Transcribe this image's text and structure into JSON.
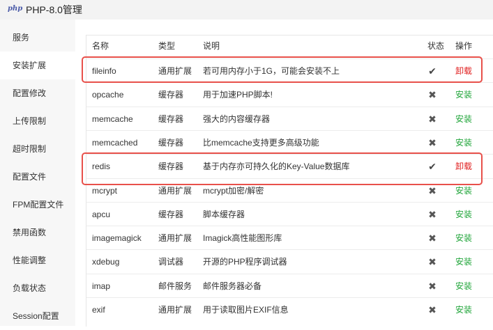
{
  "window": {
    "logo": "php",
    "title": "PHP-8.0管理"
  },
  "sidebar": {
    "items": [
      {
        "label": "服务"
      },
      {
        "label": "安装扩展"
      },
      {
        "label": "配置修改"
      },
      {
        "label": "上传限制"
      },
      {
        "label": "超时限制"
      },
      {
        "label": "配置文件"
      },
      {
        "label": "FPM配置文件"
      },
      {
        "label": "禁用函数"
      },
      {
        "label": "性能调整"
      },
      {
        "label": "负载状态"
      },
      {
        "label": "Session配置"
      }
    ],
    "active": "安装扩展"
  },
  "table": {
    "headers": {
      "name": "名称",
      "type": "类型",
      "desc": "说明",
      "status": "状态",
      "op": "操作"
    },
    "rows": [
      {
        "name": "fileinfo",
        "type": "通用扩展",
        "desc": "若可用内存小于1G，可能会安装不上",
        "installed": true,
        "op": "卸载"
      },
      {
        "name": "opcache",
        "type": "缓存器",
        "desc": "用于加速PHP脚本!",
        "installed": false,
        "op": "安装"
      },
      {
        "name": "memcache",
        "type": "缓存器",
        "desc": "强大的内容缓存器",
        "installed": false,
        "op": "安装"
      },
      {
        "name": "memcached",
        "type": "缓存器",
        "desc": "比memcache支持更多高级功能",
        "installed": false,
        "op": "安装"
      },
      {
        "name": "redis",
        "type": "缓存器",
        "desc": "基于内存亦可持久化的Key-Value数据库",
        "installed": true,
        "op": "卸载"
      },
      {
        "name": "mcrypt",
        "type": "通用扩展",
        "desc": "mcrypt加密/解密",
        "installed": false,
        "op": "安装"
      },
      {
        "name": "apcu",
        "type": "缓存器",
        "desc": "脚本缓存器",
        "installed": false,
        "op": "安装"
      },
      {
        "name": "imagemagick",
        "type": "通用扩展",
        "desc": "Imagick高性能图形库",
        "installed": false,
        "op": "安装"
      },
      {
        "name": "xdebug",
        "type": "调试器",
        "desc": "开源的PHP程序调试器",
        "installed": false,
        "op": "安装"
      },
      {
        "name": "imap",
        "type": "邮件服务",
        "desc": "邮件服务器必备",
        "installed": false,
        "op": "安装"
      },
      {
        "name": "exif",
        "type": "通用扩展",
        "desc": "用于读取图片EXIF信息",
        "installed": false,
        "op": "安装"
      }
    ]
  },
  "icons": {
    "installed": "check-icon",
    "not_installed": "cross-icon"
  },
  "colors": {
    "install": "#20a53a",
    "uninstall": "#e02020",
    "highlight": "#e8504a"
  }
}
